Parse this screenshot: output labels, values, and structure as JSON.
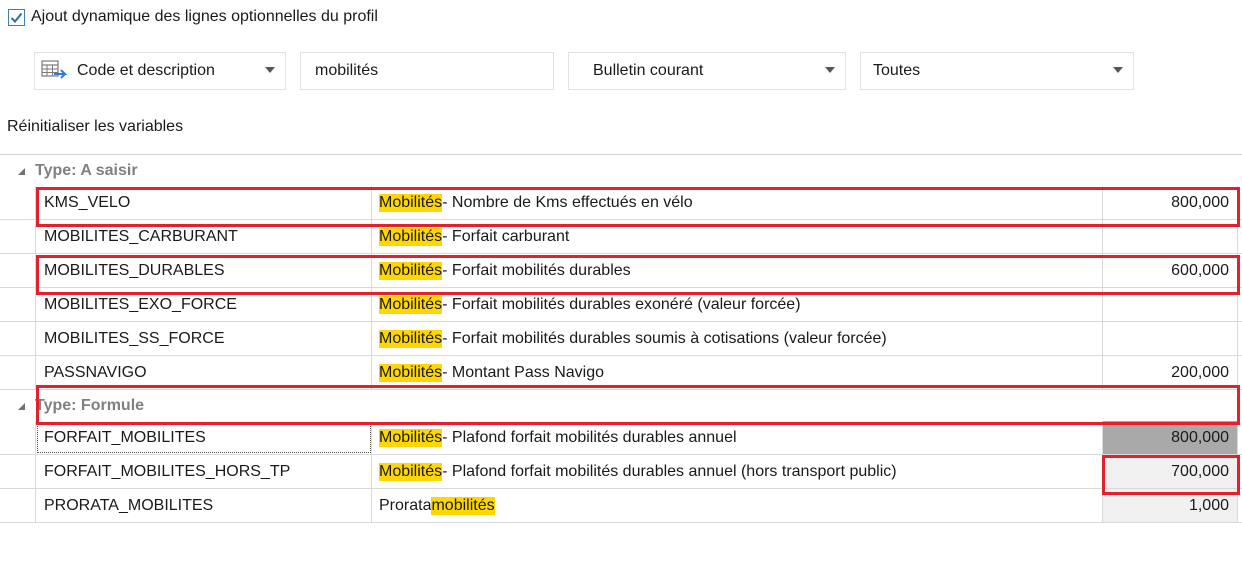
{
  "options": {
    "dynamic_lines_label": "Ajout dynamique des lignes optionnelles du profil",
    "dynamic_lines_checked": true
  },
  "toolbar": {
    "display_mode": "Code et description",
    "search_value": "mobilités",
    "bulletin_filter": "Bulletin courant",
    "scope_filter": "Toutes"
  },
  "reset_label": "Réinitialiser les variables",
  "groups": [
    {
      "label": "Type: A saisir",
      "rows": [
        {
          "code": "KMS_VELO",
          "highlight": "Mobilités",
          "desc": " - Nombre de Kms effectués en vélo",
          "value": "800,000"
        },
        {
          "code": "MOBILITES_CARBURANT",
          "highlight": "Mobilités",
          "desc": " - Forfait carburant",
          "value": ""
        },
        {
          "code": "MOBILITES_DURABLES",
          "highlight": "Mobilités",
          "desc": " - Forfait mobilités durables",
          "value": "600,000"
        },
        {
          "code": "MOBILITES_EXO_FORCE",
          "highlight": "Mobilités",
          "desc": " - Forfait mobilités durables exonéré (valeur forcée)",
          "value": ""
        },
        {
          "code": "MOBILITES_SS_FORCE",
          "highlight": "Mobilités",
          "desc": " - Forfait mobilités durables soumis à cotisations (valeur forcée)",
          "value": ""
        },
        {
          "code": "PASSNAVIGO",
          "highlight": "Mobilités",
          "desc": " - Montant Pass Navigo",
          "value": "200,000"
        }
      ]
    },
    {
      "label": "Type: Formule",
      "rows": [
        {
          "code": "FORFAIT_MOBILITES",
          "highlight": "Mobilités",
          "desc": " - Plafond forfait mobilités durables annuel",
          "value": "800,000"
        },
        {
          "code": "FORFAIT_MOBILITES_HORS_TP",
          "highlight": "Mobilités",
          "desc": " - Plafond forfait mobilités durables annuel (hors transport public)",
          "value": "700,000"
        },
        {
          "code": "PRORATA_MOBILITES",
          "prefix": "Prorata ",
          "highlight": "mobilités",
          "desc": "",
          "value": "1,000"
        }
      ]
    }
  ],
  "colors": {
    "highlight": "#ffd700",
    "annotation_box": "#e3202b",
    "formula_value_bg": "#f0f0f0",
    "selected_value_bg": "#a9a9a9"
  }
}
